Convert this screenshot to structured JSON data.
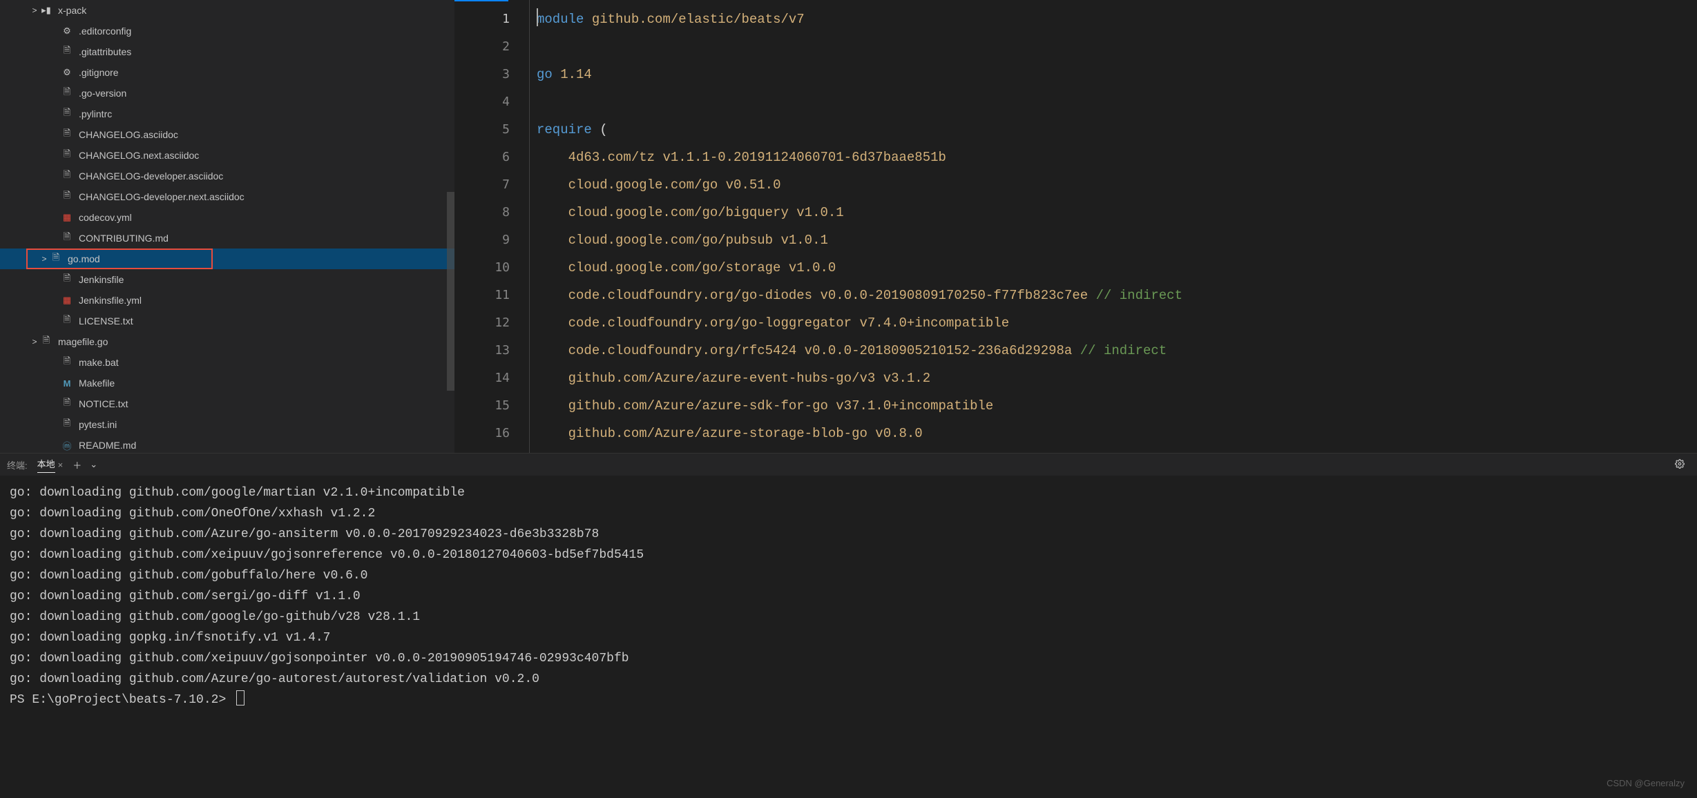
{
  "sidebar": {
    "items": [
      {
        "icon": "folder",
        "label": "x-pack",
        "indent": 42,
        "chev": ">",
        "selected": false
      },
      {
        "icon": "gear",
        "label": ".editorconfig",
        "indent": 72,
        "chev": "",
        "selected": false
      },
      {
        "icon": "file",
        "label": ".gitattributes",
        "indent": 72,
        "chev": "",
        "selected": false
      },
      {
        "icon": "gear",
        "label": ".gitignore",
        "indent": 72,
        "chev": "",
        "selected": false
      },
      {
        "icon": "file",
        "label": ".go-version",
        "indent": 72,
        "chev": "",
        "selected": false
      },
      {
        "icon": "file",
        "label": ".pylintrc",
        "indent": 72,
        "chev": "",
        "selected": false
      },
      {
        "icon": "file",
        "label": "CHANGELOG.asciidoc",
        "indent": 72,
        "chev": "",
        "selected": false
      },
      {
        "icon": "file",
        "label": "CHANGELOG.next.asciidoc",
        "indent": 72,
        "chev": "",
        "selected": false
      },
      {
        "icon": "file",
        "label": "CHANGELOG-developer.asciidoc",
        "indent": 72,
        "chev": "",
        "selected": false
      },
      {
        "icon": "file",
        "label": "CHANGELOG-developer.next.asciidoc",
        "indent": 72,
        "chev": "",
        "selected": false
      },
      {
        "icon": "yml",
        "label": "codecov.yml",
        "indent": 72,
        "chev": "",
        "selected": false
      },
      {
        "icon": "file",
        "label": "CONTRIBUTING.md",
        "indent": 72,
        "chev": "",
        "selected": false
      },
      {
        "icon": "file",
        "label": "go.mod",
        "indent": 56,
        "chev": ">",
        "selected": true
      },
      {
        "icon": "file",
        "label": "Jenkinsfile",
        "indent": 72,
        "chev": "",
        "selected": false
      },
      {
        "icon": "yml",
        "label": "Jenkinsfile.yml",
        "indent": 72,
        "chev": "",
        "selected": false
      },
      {
        "icon": "file",
        "label": "LICENSE.txt",
        "indent": 72,
        "chev": "",
        "selected": false
      },
      {
        "icon": "file",
        "label": "magefile.go",
        "indent": 42,
        "chev": ">",
        "selected": false
      },
      {
        "icon": "file",
        "label": "make.bat",
        "indent": 72,
        "chev": "",
        "selected": false
      },
      {
        "icon": "m",
        "label": "Makefile",
        "indent": 72,
        "chev": "",
        "selected": false
      },
      {
        "icon": "file",
        "label": "NOTICE.txt",
        "indent": 72,
        "chev": "",
        "selected": false
      },
      {
        "icon": "file",
        "label": "pytest.ini",
        "indent": 72,
        "chev": "",
        "selected": false
      },
      {
        "icon": "md",
        "label": "README.md",
        "indent": 72,
        "chev": "",
        "selected": false
      }
    ]
  },
  "editor": {
    "line_numbers": [
      "1",
      "2",
      "3",
      "4",
      "5",
      "6",
      "7",
      "8",
      "9",
      "10",
      "11",
      "12",
      "13",
      "14",
      "15",
      "16"
    ],
    "current_line": "1",
    "lines": [
      {
        "tokens": [
          {
            "c": "tk-kw",
            "t": "module"
          },
          {
            "c": "tk-punc",
            "t": " "
          },
          {
            "c": "tk-id",
            "t": "github.com/elastic/beats/v7"
          }
        ]
      },
      {
        "tokens": []
      },
      {
        "tokens": [
          {
            "c": "tk-kw",
            "t": "go"
          },
          {
            "c": "tk-punc",
            "t": " "
          },
          {
            "c": "tk-num",
            "t": "1.14"
          }
        ]
      },
      {
        "tokens": []
      },
      {
        "tokens": [
          {
            "c": "tk-kw",
            "t": "require"
          },
          {
            "c": "tk-punc",
            "t": " ("
          }
        ]
      },
      {
        "tokens": [
          {
            "c": "tk-punc",
            "t": "    "
          },
          {
            "c": "tk-id",
            "t": "4d63.com/tz"
          },
          {
            "c": "tk-punc",
            "t": " "
          },
          {
            "c": "tk-num",
            "t": "v1.1.1-0.20191124060701-6d37baae851b"
          }
        ]
      },
      {
        "tokens": [
          {
            "c": "tk-punc",
            "t": "    "
          },
          {
            "c": "tk-id",
            "t": "cloud.google.com/go"
          },
          {
            "c": "tk-punc",
            "t": " "
          },
          {
            "c": "tk-num",
            "t": "v0.51.0"
          }
        ]
      },
      {
        "tokens": [
          {
            "c": "tk-punc",
            "t": "    "
          },
          {
            "c": "tk-id",
            "t": "cloud.google.com/go/bigquery"
          },
          {
            "c": "tk-punc",
            "t": " "
          },
          {
            "c": "tk-num",
            "t": "v1.0.1"
          }
        ]
      },
      {
        "tokens": [
          {
            "c": "tk-punc",
            "t": "    "
          },
          {
            "c": "tk-id",
            "t": "cloud.google.com/go/pubsub"
          },
          {
            "c": "tk-punc",
            "t": " "
          },
          {
            "c": "tk-num",
            "t": "v1.0.1"
          }
        ]
      },
      {
        "tokens": [
          {
            "c": "tk-punc",
            "t": "    "
          },
          {
            "c": "tk-id",
            "t": "cloud.google.com/go/storage"
          },
          {
            "c": "tk-punc",
            "t": " "
          },
          {
            "c": "tk-num",
            "t": "v1.0.0"
          }
        ]
      },
      {
        "tokens": [
          {
            "c": "tk-punc",
            "t": "    "
          },
          {
            "c": "tk-id",
            "t": "code.cloudfoundry.org/go-diodes"
          },
          {
            "c": "tk-punc",
            "t": " "
          },
          {
            "c": "tk-num",
            "t": "v0.0.0-20190809170250-f77fb823c7ee"
          },
          {
            "c": "tk-punc",
            "t": " "
          },
          {
            "c": "tk-com",
            "t": "// indirect"
          }
        ]
      },
      {
        "tokens": [
          {
            "c": "tk-punc",
            "t": "    "
          },
          {
            "c": "tk-id",
            "t": "code.cloudfoundry.org/go-loggregator"
          },
          {
            "c": "tk-punc",
            "t": " "
          },
          {
            "c": "tk-num",
            "t": "v7.4.0+incompatible"
          }
        ]
      },
      {
        "tokens": [
          {
            "c": "tk-punc",
            "t": "    "
          },
          {
            "c": "tk-id",
            "t": "code.cloudfoundry.org/rfc5424"
          },
          {
            "c": "tk-punc",
            "t": " "
          },
          {
            "c": "tk-num",
            "t": "v0.0.0-20180905210152-236a6d29298a"
          },
          {
            "c": "tk-punc",
            "t": " "
          },
          {
            "c": "tk-com",
            "t": "// indirect"
          }
        ]
      },
      {
        "tokens": [
          {
            "c": "tk-punc",
            "t": "    "
          },
          {
            "c": "tk-id",
            "t": "github.com/Azure/azure-event-hubs-go/v3"
          },
          {
            "c": "tk-punc",
            "t": " "
          },
          {
            "c": "tk-num",
            "t": "v3.1.2"
          }
        ]
      },
      {
        "tokens": [
          {
            "c": "tk-punc",
            "t": "    "
          },
          {
            "c": "tk-id",
            "t": "github.com/Azure/azure-sdk-for-go"
          },
          {
            "c": "tk-punc",
            "t": " "
          },
          {
            "c": "tk-num",
            "t": "v37.1.0+incompatible"
          }
        ]
      },
      {
        "tokens": [
          {
            "c": "tk-punc",
            "t": "    "
          },
          {
            "c": "tk-id",
            "t": "github.com/Azure/azure-storage-blob-go"
          },
          {
            "c": "tk-punc",
            "t": " "
          },
          {
            "c": "tk-num",
            "t": "v0.8.0"
          }
        ]
      }
    ]
  },
  "terminal": {
    "tabs_label": "终端:",
    "active_tab": "本地",
    "lines": [
      "go: downloading github.com/google/martian v2.1.0+incompatible",
      "go: downloading github.com/OneOfOne/xxhash v1.2.2",
      "go: downloading github.com/Azure/go-ansiterm v0.0.0-20170929234023-d6e3b3328b78",
      "go: downloading github.com/xeipuuv/gojsonreference v0.0.0-20180127040603-bd5ef7bd5415",
      "go: downloading github.com/gobuffalo/here v0.6.0",
      "go: downloading github.com/sergi/go-diff v1.1.0",
      "go: downloading github.com/google/go-github/v28 v28.1.1",
      "go: downloading gopkg.in/fsnotify.v1 v1.4.7",
      "go: downloading github.com/xeipuuv/gojsonpointer v0.0.0-20190905194746-02993c407bfb",
      "go: downloading github.com/Azure/go-autorest/autorest/validation v0.2.0"
    ],
    "prompt": "PS E:\\goProject\\beats-7.10.2> "
  },
  "watermark": "CSDN @Generalzy"
}
